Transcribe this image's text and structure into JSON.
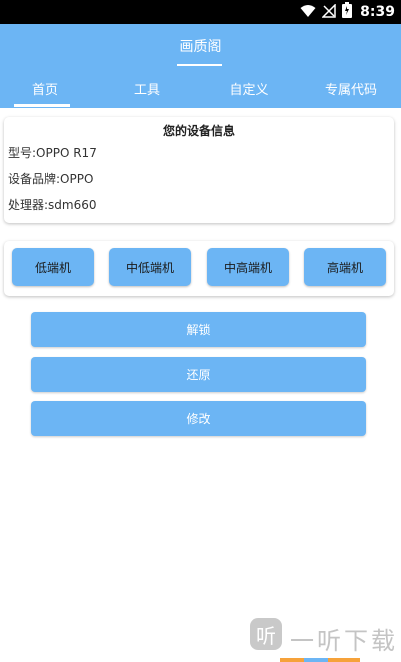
{
  "status_bar": {
    "time": "8:39",
    "icons": [
      "wifi-icon",
      "no-signal-icon",
      "battery-icon"
    ]
  },
  "header": {
    "title": "画质阁"
  },
  "tabs": [
    {
      "label": "首页",
      "active": true
    },
    {
      "label": "工具",
      "active": false
    },
    {
      "label": "自定义",
      "active": false
    },
    {
      "label": "专属代码",
      "active": false
    }
  ],
  "device_info": {
    "title": "您的设备信息",
    "model": "型号:OPPO R17",
    "brand": "设备品牌:OPPO",
    "processor": "处理器:sdm660"
  },
  "tiers": [
    {
      "label": "低端机"
    },
    {
      "label": "中低端机"
    },
    {
      "label": "中高端机"
    },
    {
      "label": "高端机"
    }
  ],
  "actions": [
    {
      "label": "解锁"
    },
    {
      "label": "还原"
    },
    {
      "label": "修改"
    }
  ],
  "watermark": {
    "icon_glyph": "听",
    "text": "一听下载"
  },
  "colors": {
    "accent": "#6cb5f4",
    "status_bar": "#000000",
    "background": "#ffffff"
  }
}
